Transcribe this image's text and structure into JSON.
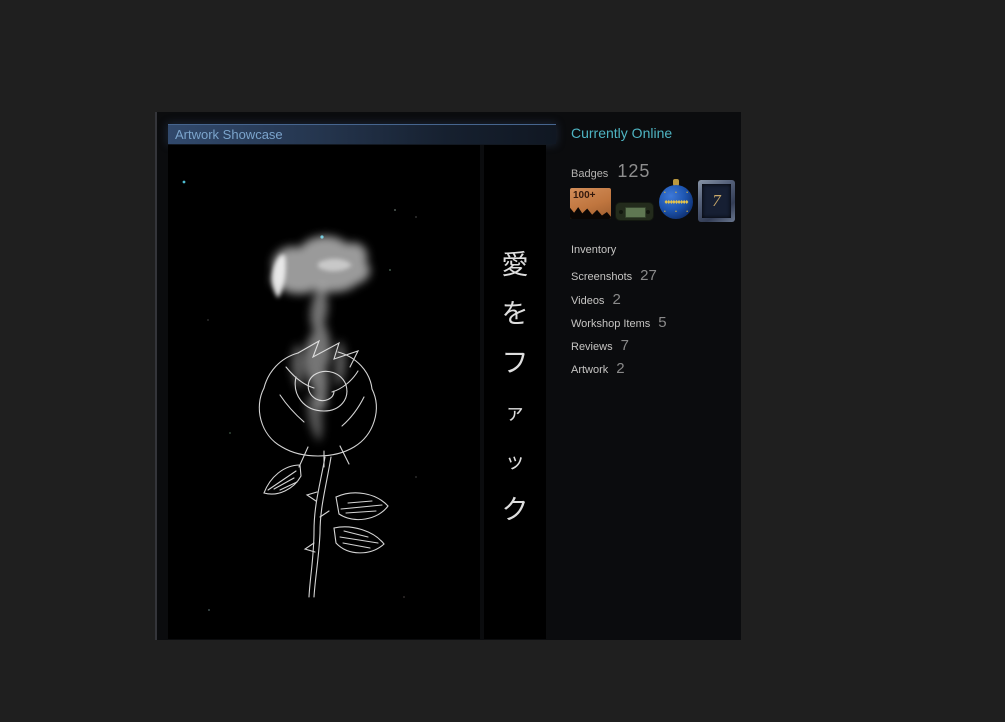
{
  "colors": {
    "online": "#4eb4c2",
    "showcase_title": "#7ba4cc",
    "badge_orange": "#c0763f",
    "ornament_blue": "#1d55b0",
    "level_badge_gold": "#c8a86a"
  },
  "showcase": {
    "title": "Artwork Showcase",
    "main_artwork": {
      "description": "burning-rose-line-art"
    },
    "second_artwork": {
      "characters": [
        "愛",
        "を",
        "フ",
        "ァ",
        "ッ",
        "ク"
      ]
    }
  },
  "profile": {
    "status": {
      "label": "Currently Online"
    },
    "badges": {
      "label": "Badges",
      "count": "125",
      "icons": [
        {
          "name": "games-owned-badge",
          "text": "100+"
        },
        {
          "name": "handheld-console-badge",
          "text": ""
        },
        {
          "name": "winter-ornament-badge",
          "text": ""
        },
        {
          "name": "level-badge",
          "text": "7"
        }
      ]
    },
    "stats": [
      {
        "label": "Inventory",
        "value": ""
      },
      {
        "label": "Screenshots",
        "value": "27"
      },
      {
        "label": "Videos",
        "value": "2"
      },
      {
        "label": "Workshop Items",
        "value": "5"
      },
      {
        "label": "Reviews",
        "value": "7"
      },
      {
        "label": "Artwork",
        "value": "2"
      }
    ]
  }
}
